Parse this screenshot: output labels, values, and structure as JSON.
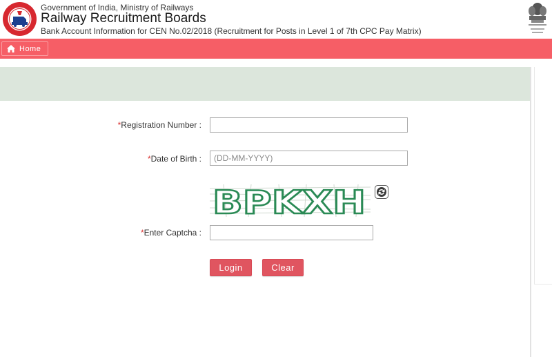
{
  "header": {
    "org_line": "Government of India, Ministry of Railways",
    "title": "Railway Recruitment Boards",
    "subtitle": "Bank Account Information for CEN No.02/2018 (Recruitment for Posts in Level 1 of 7th CPC Pay Matrix)",
    "logo_icon": "rrb-logo-icon",
    "emblem_icon": "national-emblem-icon"
  },
  "nav": {
    "home_label": "Home",
    "home_icon": "home-icon"
  },
  "form": {
    "required_mark": "*",
    "registration": {
      "label": "Registration Number :",
      "value": "",
      "placeholder": ""
    },
    "dob": {
      "label": "Date of Birth :",
      "value": "",
      "placeholder": "(DD-MM-YYYY)"
    },
    "captcha": {
      "label": "Enter Captcha :",
      "value": "",
      "placeholder": "",
      "code": "BPKXH",
      "refresh_icon": "refresh-icon"
    },
    "login_label": "Login",
    "clear_label": "Clear"
  },
  "colors": {
    "navbar": "#f65e66",
    "panel_band": "#dce6dc",
    "button": "#e05560",
    "required": "#d9302f"
  }
}
